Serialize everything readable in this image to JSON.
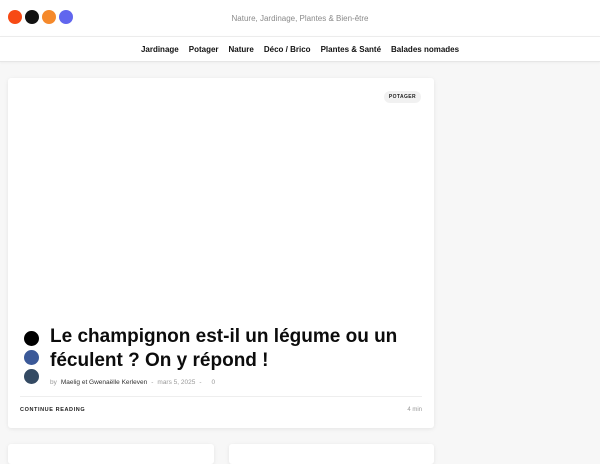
{
  "header": {
    "tagline": "Nature, Jardinage, Plantes & Bien-être",
    "logo_dot_colors": [
      "#f74a14",
      "#111111",
      "#f5892b",
      "#6166ee"
    ]
  },
  "nav": {
    "items": [
      {
        "label": "Jardinage"
      },
      {
        "label": "Potager"
      },
      {
        "label": "Nature"
      },
      {
        "label": "Déco / Brico"
      },
      {
        "label": "Plantes & Santé"
      },
      {
        "label": "Balades nomades"
      }
    ]
  },
  "article": {
    "category": "POTAGER",
    "title": "Le champignon est-il un légume ou un féculent ? On y répond !",
    "by": "by",
    "author": "Maelig et Gwenaëlle Kerleven",
    "sep1": "-",
    "date": "mars 5, 2025",
    "sep2": "-",
    "comments": "0",
    "continue_label": "CONTINUE READING",
    "read_time": "4 min",
    "share_colors": [
      "#000000",
      "#3b5998",
      "#344a63"
    ]
  }
}
